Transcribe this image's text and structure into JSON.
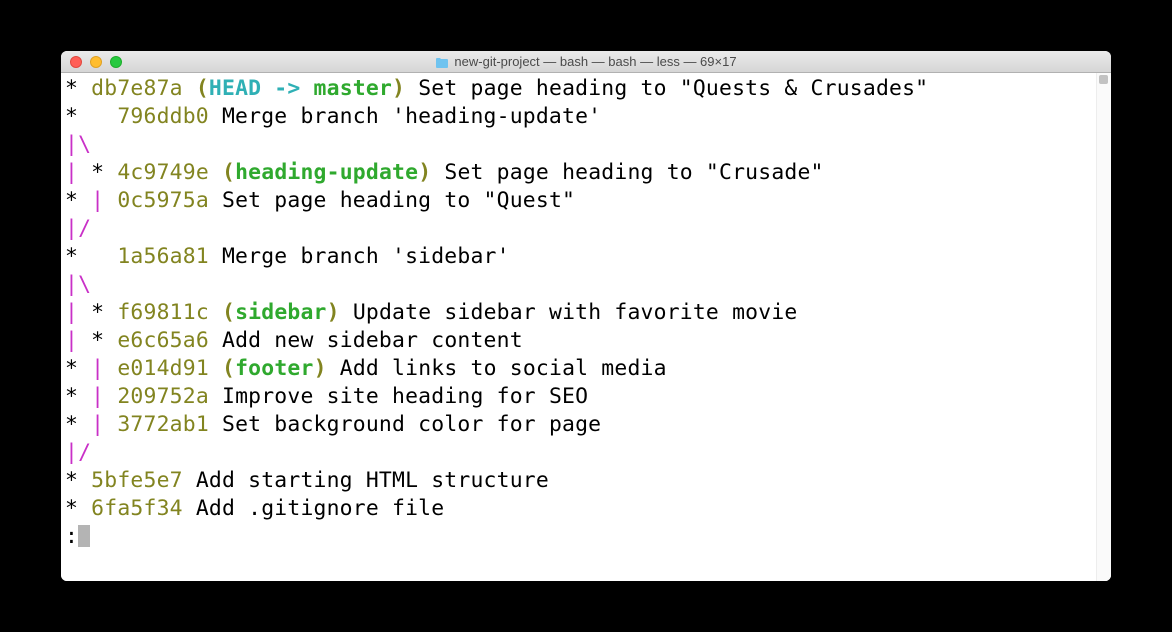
{
  "titlebar": {
    "title": "new-git-project — bash — bash — less — 69×17"
  },
  "log": {
    "lines": [
      {
        "segments": [
          {
            "text": "* ",
            "cls": ""
          },
          {
            "text": "db7e87a",
            "cls": "c-olive"
          },
          {
            "text": " (",
            "cls": "c-olive-bold"
          },
          {
            "text": "HEAD -> ",
            "cls": "c-cyan-bold"
          },
          {
            "text": "master",
            "cls": "c-green-bold"
          },
          {
            "text": ")",
            "cls": "c-olive-bold"
          },
          {
            "text": " Set page heading to \"Quests & Crusades\"",
            "cls": ""
          }
        ]
      },
      {
        "segments": [
          {
            "text": "*   ",
            "cls": ""
          },
          {
            "text": "796ddb0",
            "cls": "c-olive"
          },
          {
            "text": " Merge branch 'heading-update'",
            "cls": ""
          }
        ]
      },
      {
        "segments": [
          {
            "text": "|",
            "cls": "c-magenta"
          },
          {
            "text": "\\",
            "cls": "c-magenta"
          }
        ]
      },
      {
        "segments": [
          {
            "text": "| ",
            "cls": "c-magenta"
          },
          {
            "text": "* ",
            "cls": ""
          },
          {
            "text": "4c9749e",
            "cls": "c-olive"
          },
          {
            "text": " (",
            "cls": "c-olive-bold"
          },
          {
            "text": "heading-update",
            "cls": "c-green-bold"
          },
          {
            "text": ")",
            "cls": "c-olive-bold"
          },
          {
            "text": " Set page heading to \"Crusade\"",
            "cls": ""
          }
        ]
      },
      {
        "segments": [
          {
            "text": "* ",
            "cls": ""
          },
          {
            "text": "| ",
            "cls": "c-magenta"
          },
          {
            "text": "0c5975a",
            "cls": "c-olive"
          },
          {
            "text": " Set page heading to \"Quest\"",
            "cls": ""
          }
        ]
      },
      {
        "segments": [
          {
            "text": "|",
            "cls": "c-magenta"
          },
          {
            "text": "/",
            "cls": "c-magenta"
          }
        ]
      },
      {
        "segments": [
          {
            "text": "*   ",
            "cls": ""
          },
          {
            "text": "1a56a81",
            "cls": "c-olive"
          },
          {
            "text": " Merge branch 'sidebar'",
            "cls": ""
          }
        ]
      },
      {
        "segments": [
          {
            "text": "|",
            "cls": "c-magenta"
          },
          {
            "text": "\\",
            "cls": "c-magenta"
          }
        ]
      },
      {
        "segments": [
          {
            "text": "| ",
            "cls": "c-magenta"
          },
          {
            "text": "* ",
            "cls": ""
          },
          {
            "text": "f69811c",
            "cls": "c-olive"
          },
          {
            "text": " (",
            "cls": "c-olive-bold"
          },
          {
            "text": "sidebar",
            "cls": "c-green-bold"
          },
          {
            "text": ")",
            "cls": "c-olive-bold"
          },
          {
            "text": " Update sidebar with favorite movie",
            "cls": ""
          }
        ]
      },
      {
        "segments": [
          {
            "text": "| ",
            "cls": "c-magenta"
          },
          {
            "text": "* ",
            "cls": ""
          },
          {
            "text": "e6c65a6",
            "cls": "c-olive"
          },
          {
            "text": " Add new sidebar content",
            "cls": ""
          }
        ]
      },
      {
        "segments": [
          {
            "text": "* ",
            "cls": ""
          },
          {
            "text": "| ",
            "cls": "c-magenta"
          },
          {
            "text": "e014d91",
            "cls": "c-olive"
          },
          {
            "text": " (",
            "cls": "c-olive-bold"
          },
          {
            "text": "footer",
            "cls": "c-green-bold"
          },
          {
            "text": ")",
            "cls": "c-olive-bold"
          },
          {
            "text": " Add links to social media",
            "cls": ""
          }
        ]
      },
      {
        "segments": [
          {
            "text": "* ",
            "cls": ""
          },
          {
            "text": "| ",
            "cls": "c-magenta"
          },
          {
            "text": "209752a",
            "cls": "c-olive"
          },
          {
            "text": " Improve site heading for SEO",
            "cls": ""
          }
        ]
      },
      {
        "segments": [
          {
            "text": "* ",
            "cls": ""
          },
          {
            "text": "| ",
            "cls": "c-magenta"
          },
          {
            "text": "3772ab1",
            "cls": "c-olive"
          },
          {
            "text": " Set background color for page",
            "cls": ""
          }
        ]
      },
      {
        "segments": [
          {
            "text": "|",
            "cls": "c-magenta"
          },
          {
            "text": "/",
            "cls": "c-magenta"
          }
        ]
      },
      {
        "segments": [
          {
            "text": "* ",
            "cls": ""
          },
          {
            "text": "5bfe5e7",
            "cls": "c-olive"
          },
          {
            "text": " Add starting HTML structure",
            "cls": ""
          }
        ]
      },
      {
        "segments": [
          {
            "text": "* ",
            "cls": ""
          },
          {
            "text": "6fa5f34",
            "cls": "c-olive"
          },
          {
            "text": " Add .gitignore file",
            "cls": ""
          }
        ]
      }
    ],
    "prompt": ":"
  }
}
